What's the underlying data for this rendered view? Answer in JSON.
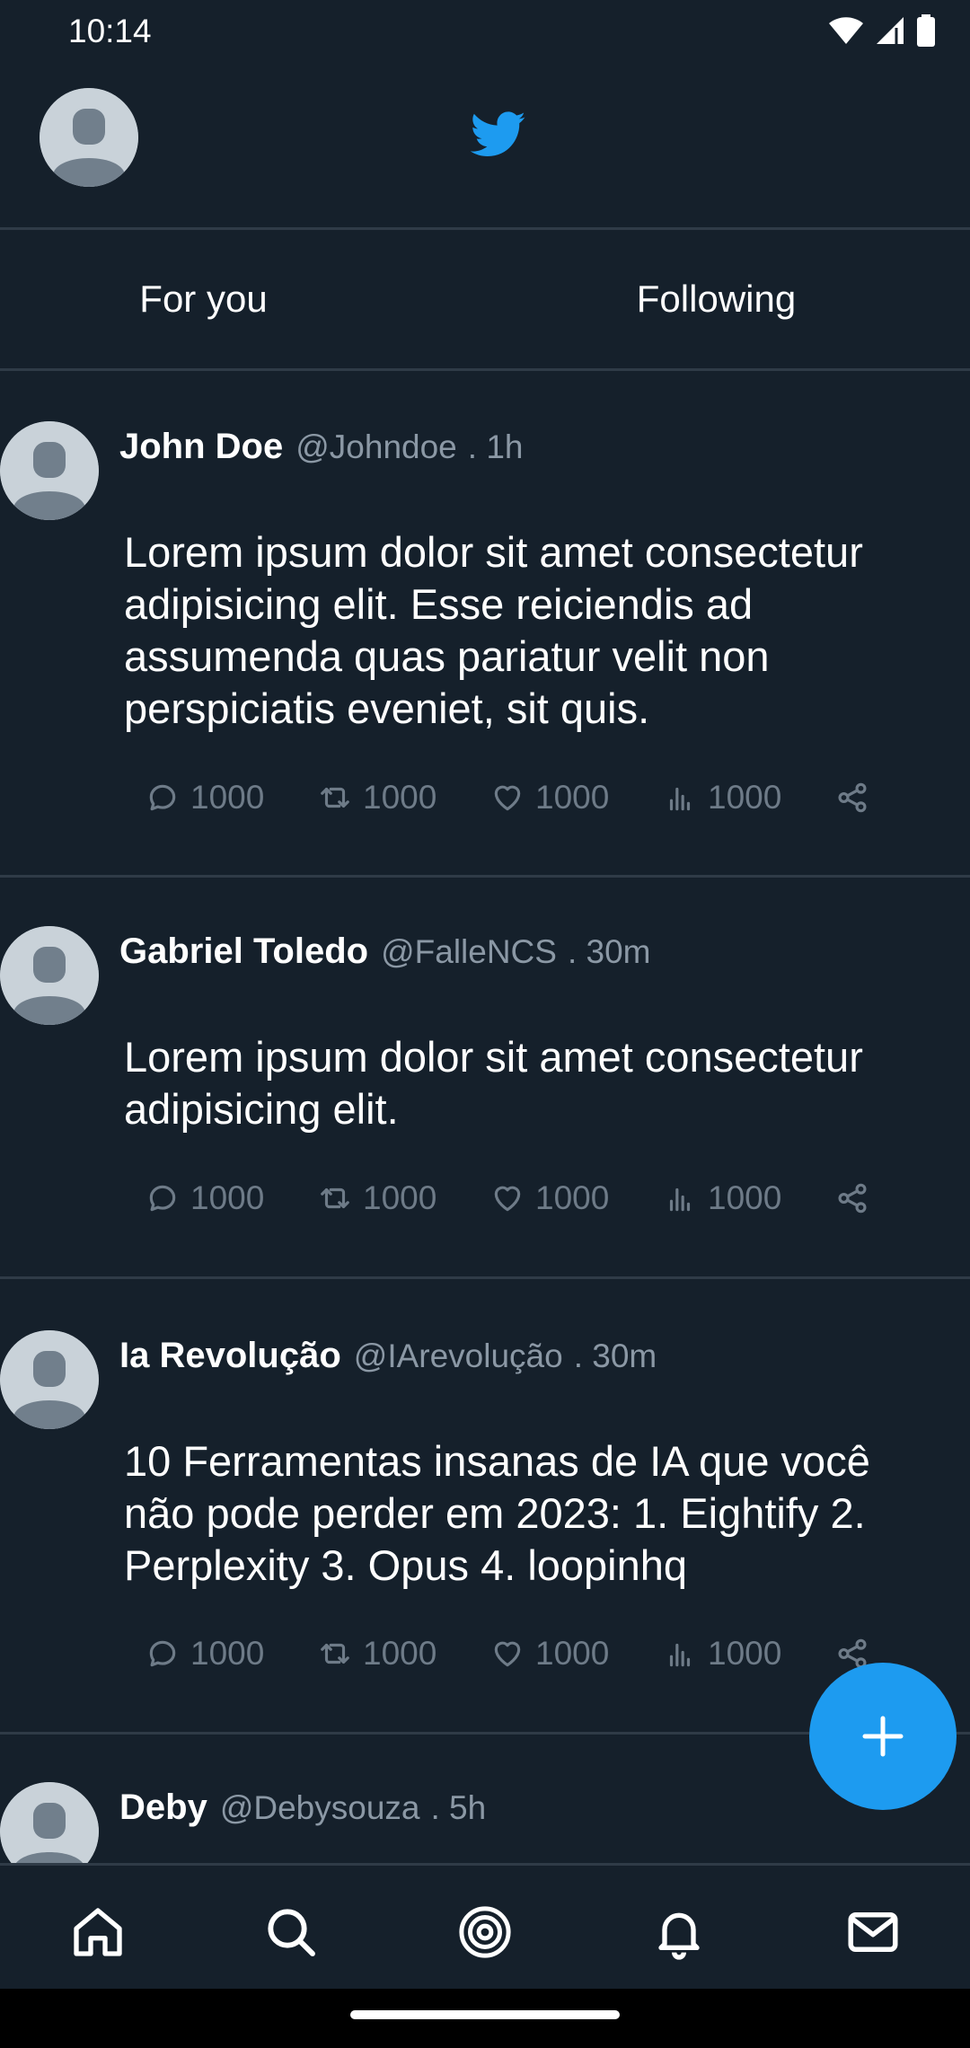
{
  "status_bar": {
    "time": "10:14"
  },
  "tabs": [
    {
      "label": "For you"
    },
    {
      "label": "Following"
    }
  ],
  "tweets": [
    {
      "name": "John Doe",
      "handle": "@Johndoe",
      "time": ". 1h",
      "text": "Lorem ipsum dolor sit amet consectetur adipisicing elit. Esse reiciendis ad assumenda quas pariatur velit non perspiciatis eveniet, sit quis.",
      "replies": "1000",
      "retweets": "1000",
      "likes": "1000",
      "views": "1000"
    },
    {
      "name": "Gabriel Toledo",
      "handle": "@FalleNCS",
      "time": ". 30m",
      "text": "Lorem ipsum dolor sit amet consectetur adipisicing elit.",
      "replies": "1000",
      "retweets": "1000",
      "likes": "1000",
      "views": "1000"
    },
    {
      "name": "Ia Revolução",
      "handle": "@IArevolução",
      "time": ". 30m",
      "text": "10 Ferramentas insanas de IA que você não pode perder em 2023:  1. Eightify 2. Perplexity 3. Opus 4. loopinhq",
      "replies": "1000",
      "retweets": "1000",
      "likes": "1000",
      "views": "1000"
    },
    {
      "name": "Deby",
      "handle": "@Debysouza",
      "time": ". 5h"
    }
  ],
  "icons": {
    "logo": "twitter-bird-icon",
    "fab": "plus-icon",
    "nav": [
      "home-icon",
      "search-icon",
      "spaces-icon",
      "bell-icon",
      "mail-icon"
    ]
  },
  "colors": {
    "background": "#15202b",
    "accent": "#1d9bf0",
    "muted": "#8b98a5",
    "divider": "#2f3b47"
  }
}
